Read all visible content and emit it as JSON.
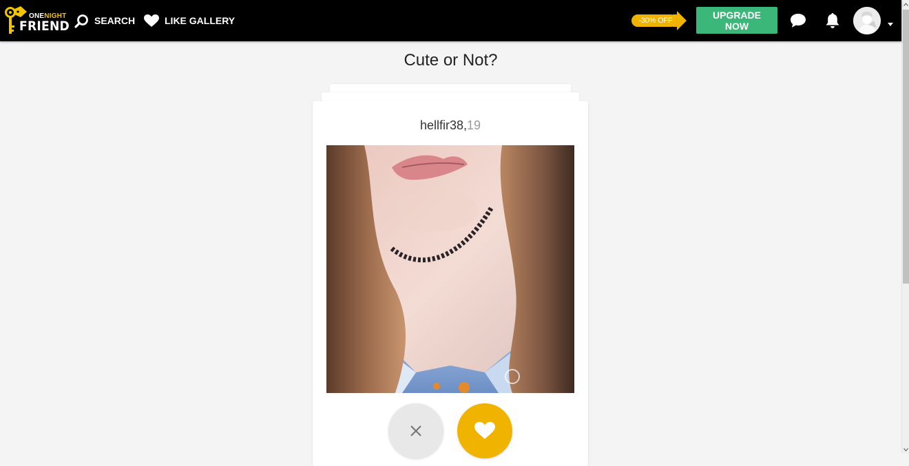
{
  "header": {
    "logo": {
      "top_line_white": "ONE",
      "top_line_yellow": "NIGHT",
      "bottom_line": "FRIEND"
    },
    "nav": {
      "search_label": "SEARCH",
      "like_gallery_label": "LIKE GALLERY"
    },
    "promo_badge": "-30% OFF",
    "upgrade_label": "UPGRADE NOW"
  },
  "icons": {
    "search": "search-icon",
    "like": "heart-icon",
    "chat": "chat-bubble-icon",
    "notifications": "bell-icon",
    "caret": "chevron-down-icon",
    "dislike": "close-icon",
    "favorite": "heart-icon"
  },
  "colors": {
    "topbar": "#000000",
    "accent_yellow": "#f0b400",
    "upgrade_green": "#3bb77a",
    "background": "#f4f4f4"
  },
  "main": {
    "title": "Cute or Not?",
    "profile": {
      "username": "hellfir38,",
      "age": "19"
    }
  }
}
